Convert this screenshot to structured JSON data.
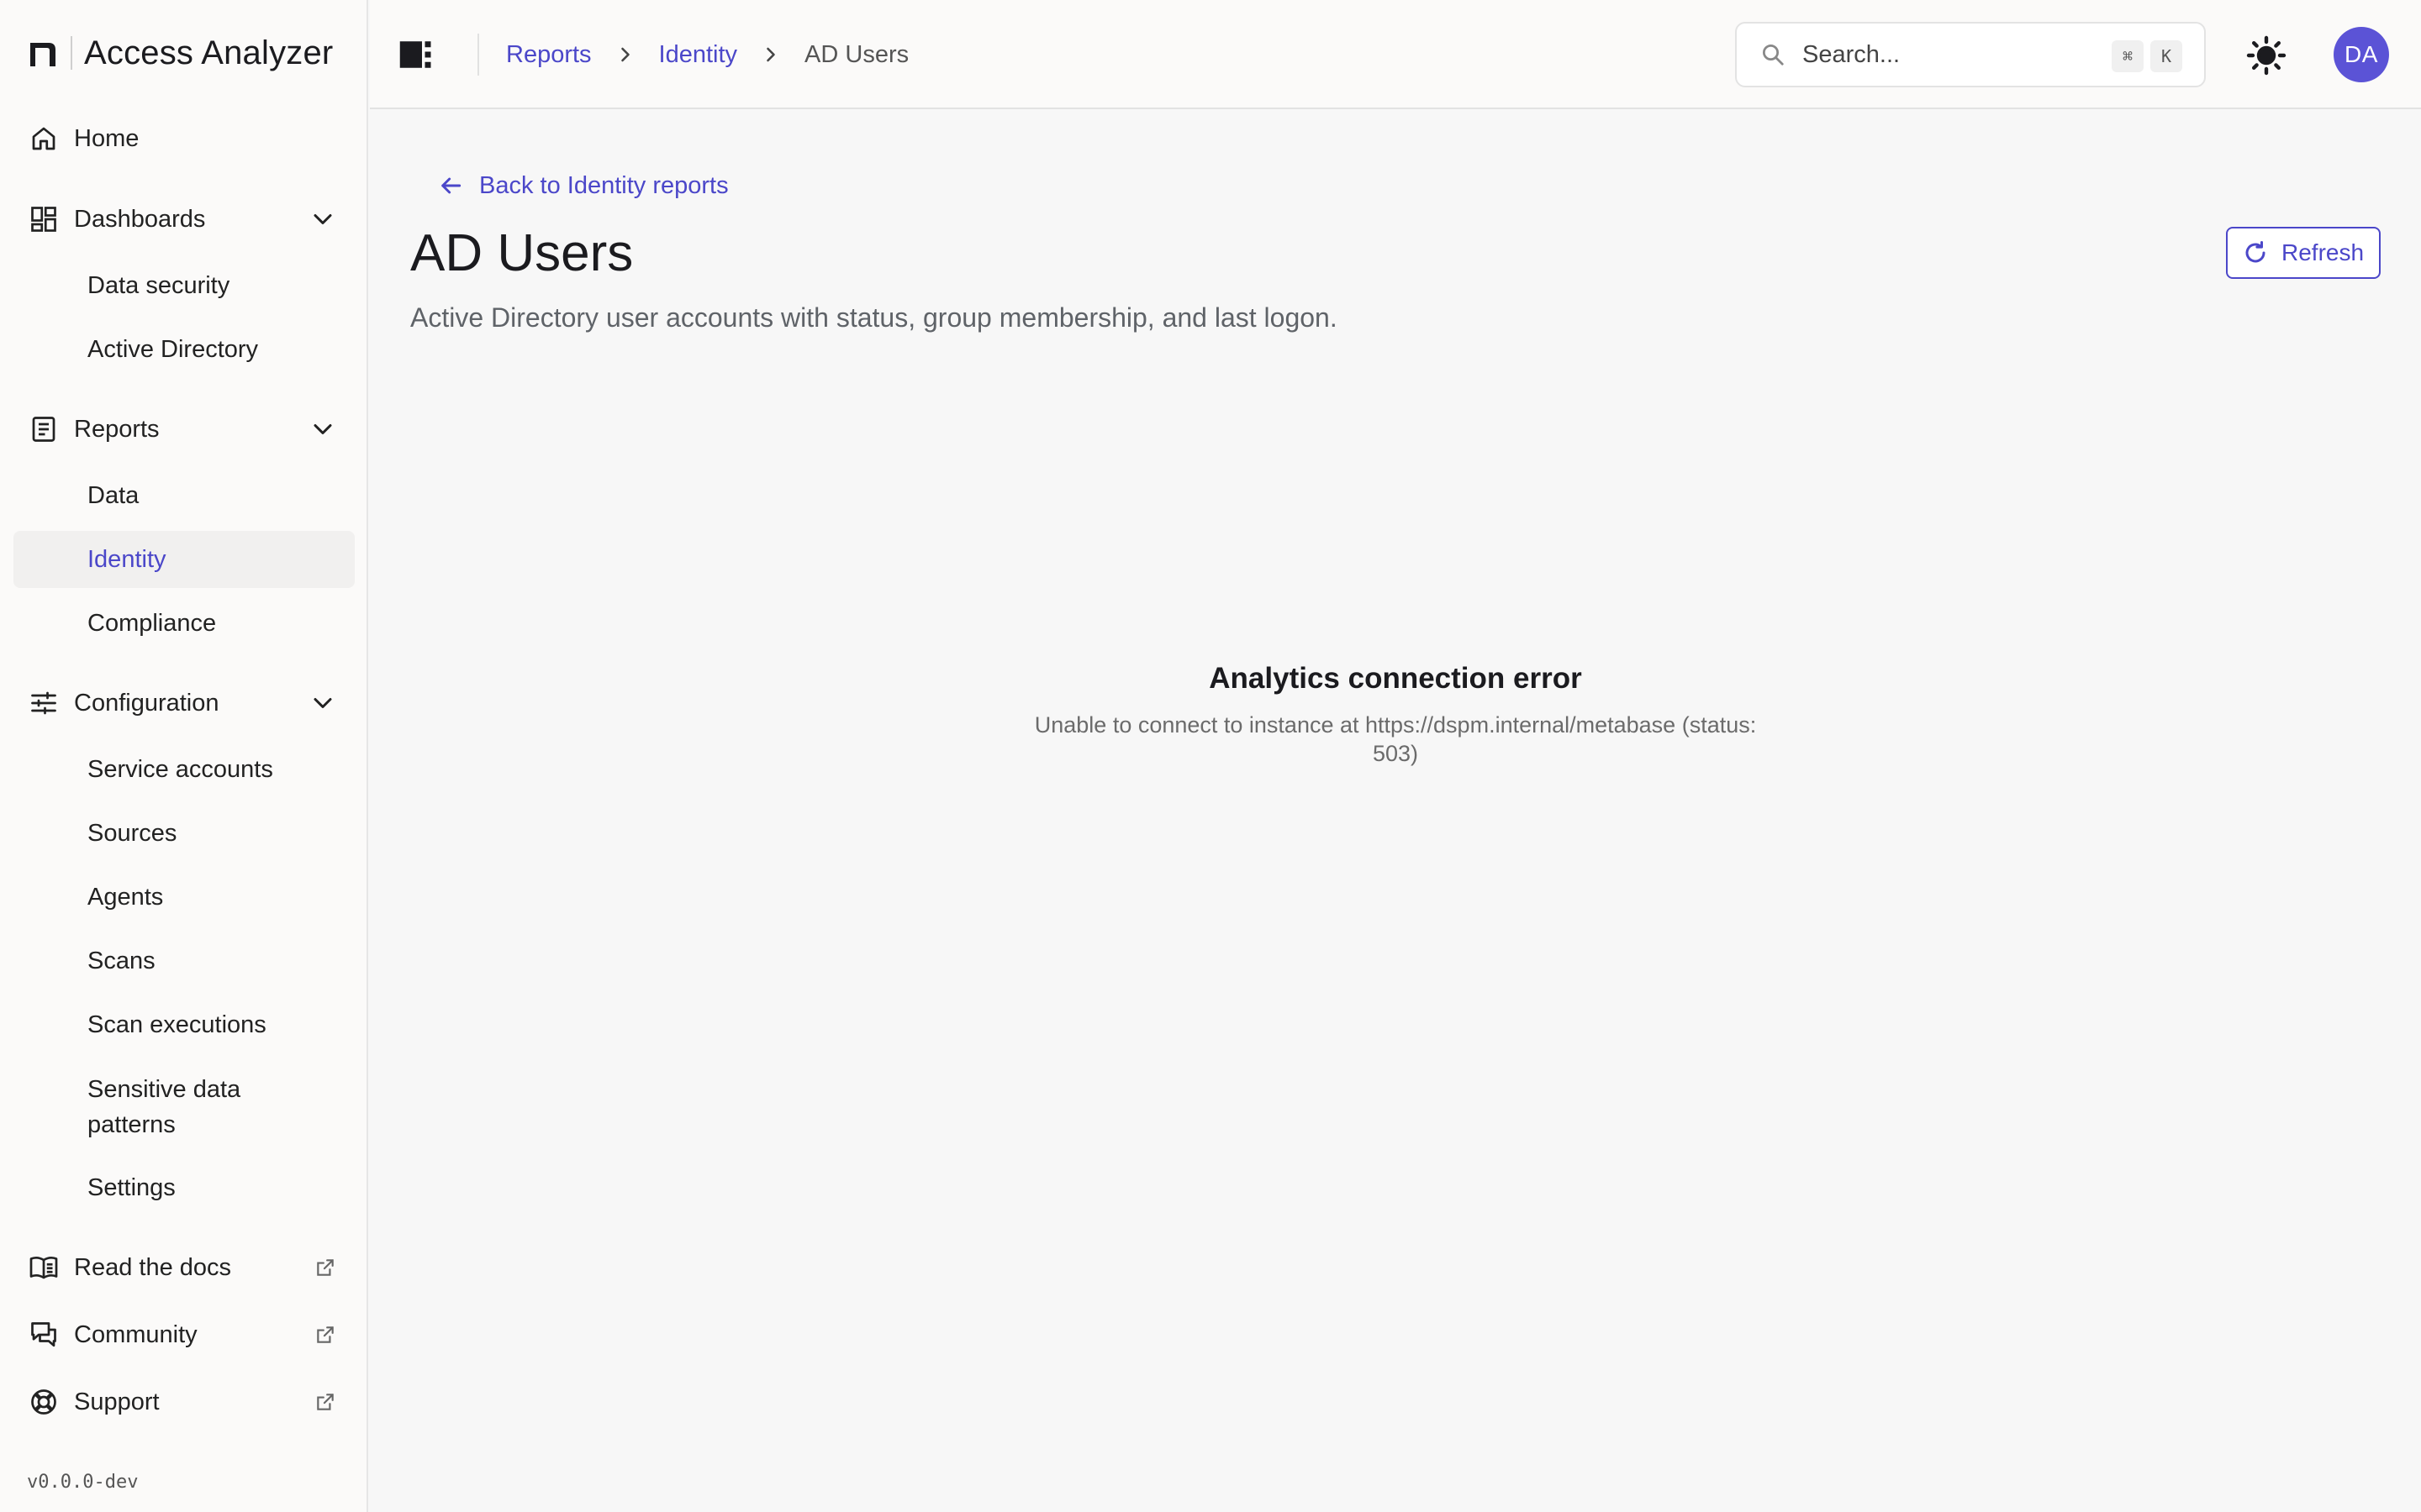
{
  "app": {
    "name": "Access Analyzer",
    "version": "v0.0.0-dev"
  },
  "colors": {
    "accent": "#4b47c9",
    "avatar_bg": "#5b53d6",
    "active_item_bg": "#f1f0ef"
  },
  "sidebar": {
    "home": {
      "label": "Home",
      "icon": "home-icon"
    },
    "dashboards": {
      "label": "Dashboards",
      "icon": "dashboard-grid-icon",
      "expanded": true,
      "items": [
        {
          "label": "Data security"
        },
        {
          "label": "Active Directory"
        }
      ]
    },
    "reports": {
      "label": "Reports",
      "icon": "report-document-icon",
      "expanded": true,
      "items": [
        {
          "label": "Data"
        },
        {
          "label": "Identity",
          "active": true
        },
        {
          "label": "Compliance"
        }
      ]
    },
    "configuration": {
      "label": "Configuration",
      "icon": "sliders-icon",
      "expanded": true,
      "items": [
        {
          "label": "Service accounts"
        },
        {
          "label": "Sources"
        },
        {
          "label": "Agents"
        },
        {
          "label": "Scans"
        },
        {
          "label": "Scan executions"
        },
        {
          "label": "Sensitive data patterns"
        },
        {
          "label": "Settings"
        }
      ]
    },
    "links": [
      {
        "label": "Read the docs",
        "icon": "book-icon",
        "external": true
      },
      {
        "label": "Community",
        "icon": "chat-bubbles-icon",
        "external": true
      },
      {
        "label": "Support",
        "icon": "lifebuoy-icon",
        "external": true
      }
    ]
  },
  "header": {
    "breadcrumb": [
      {
        "label": "Reports"
      },
      {
        "label": "Identity"
      },
      {
        "label": "AD Users"
      }
    ],
    "search": {
      "placeholder": "Search...",
      "shortcut_keys": [
        "⌘",
        "K"
      ]
    },
    "user_initials": "DA"
  },
  "main": {
    "back_link": "Back to Identity reports",
    "title": "AD Users",
    "subtitle": "Active Directory user accounts with status, group membership, and last logon.",
    "refresh_label": "Refresh",
    "error": {
      "title": "Analytics connection error",
      "message": "Unable to connect to instance at https://dspm.internal/metabase (status: 503)"
    }
  }
}
